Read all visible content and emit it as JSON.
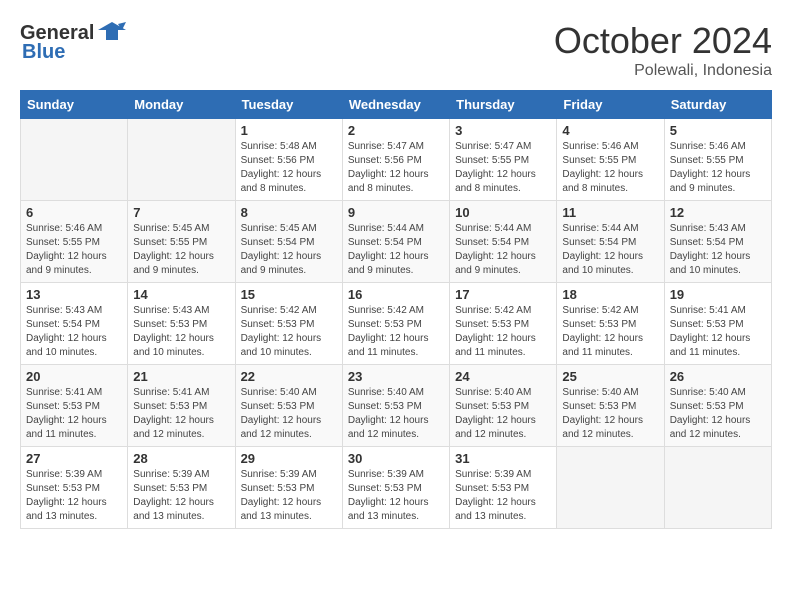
{
  "header": {
    "logo_general": "General",
    "logo_blue": "Blue",
    "month": "October 2024",
    "location": "Polewali, Indonesia"
  },
  "weekdays": [
    "Sunday",
    "Monday",
    "Tuesday",
    "Wednesday",
    "Thursday",
    "Friday",
    "Saturday"
  ],
  "weeks": [
    [
      {
        "day": "",
        "info": ""
      },
      {
        "day": "",
        "info": ""
      },
      {
        "day": "1",
        "info": "Sunrise: 5:48 AM\nSunset: 5:56 PM\nDaylight: 12 hours\nand 8 minutes."
      },
      {
        "day": "2",
        "info": "Sunrise: 5:47 AM\nSunset: 5:56 PM\nDaylight: 12 hours\nand 8 minutes."
      },
      {
        "day": "3",
        "info": "Sunrise: 5:47 AM\nSunset: 5:55 PM\nDaylight: 12 hours\nand 8 minutes."
      },
      {
        "day": "4",
        "info": "Sunrise: 5:46 AM\nSunset: 5:55 PM\nDaylight: 12 hours\nand 8 minutes."
      },
      {
        "day": "5",
        "info": "Sunrise: 5:46 AM\nSunset: 5:55 PM\nDaylight: 12 hours\nand 9 minutes."
      }
    ],
    [
      {
        "day": "6",
        "info": "Sunrise: 5:46 AM\nSunset: 5:55 PM\nDaylight: 12 hours\nand 9 minutes."
      },
      {
        "day": "7",
        "info": "Sunrise: 5:45 AM\nSunset: 5:55 PM\nDaylight: 12 hours\nand 9 minutes."
      },
      {
        "day": "8",
        "info": "Sunrise: 5:45 AM\nSunset: 5:54 PM\nDaylight: 12 hours\nand 9 minutes."
      },
      {
        "day": "9",
        "info": "Sunrise: 5:44 AM\nSunset: 5:54 PM\nDaylight: 12 hours\nand 9 minutes."
      },
      {
        "day": "10",
        "info": "Sunrise: 5:44 AM\nSunset: 5:54 PM\nDaylight: 12 hours\nand 9 minutes."
      },
      {
        "day": "11",
        "info": "Sunrise: 5:44 AM\nSunset: 5:54 PM\nDaylight: 12 hours\nand 10 minutes."
      },
      {
        "day": "12",
        "info": "Sunrise: 5:43 AM\nSunset: 5:54 PM\nDaylight: 12 hours\nand 10 minutes."
      }
    ],
    [
      {
        "day": "13",
        "info": "Sunrise: 5:43 AM\nSunset: 5:54 PM\nDaylight: 12 hours\nand 10 minutes."
      },
      {
        "day": "14",
        "info": "Sunrise: 5:43 AM\nSunset: 5:53 PM\nDaylight: 12 hours\nand 10 minutes."
      },
      {
        "day": "15",
        "info": "Sunrise: 5:42 AM\nSunset: 5:53 PM\nDaylight: 12 hours\nand 10 minutes."
      },
      {
        "day": "16",
        "info": "Sunrise: 5:42 AM\nSunset: 5:53 PM\nDaylight: 12 hours\nand 11 minutes."
      },
      {
        "day": "17",
        "info": "Sunrise: 5:42 AM\nSunset: 5:53 PM\nDaylight: 12 hours\nand 11 minutes."
      },
      {
        "day": "18",
        "info": "Sunrise: 5:42 AM\nSunset: 5:53 PM\nDaylight: 12 hours\nand 11 minutes."
      },
      {
        "day": "19",
        "info": "Sunrise: 5:41 AM\nSunset: 5:53 PM\nDaylight: 12 hours\nand 11 minutes."
      }
    ],
    [
      {
        "day": "20",
        "info": "Sunrise: 5:41 AM\nSunset: 5:53 PM\nDaylight: 12 hours\nand 11 minutes."
      },
      {
        "day": "21",
        "info": "Sunrise: 5:41 AM\nSunset: 5:53 PM\nDaylight: 12 hours\nand 12 minutes."
      },
      {
        "day": "22",
        "info": "Sunrise: 5:40 AM\nSunset: 5:53 PM\nDaylight: 12 hours\nand 12 minutes."
      },
      {
        "day": "23",
        "info": "Sunrise: 5:40 AM\nSunset: 5:53 PM\nDaylight: 12 hours\nand 12 minutes."
      },
      {
        "day": "24",
        "info": "Sunrise: 5:40 AM\nSunset: 5:53 PM\nDaylight: 12 hours\nand 12 minutes."
      },
      {
        "day": "25",
        "info": "Sunrise: 5:40 AM\nSunset: 5:53 PM\nDaylight: 12 hours\nand 12 minutes."
      },
      {
        "day": "26",
        "info": "Sunrise: 5:40 AM\nSunset: 5:53 PM\nDaylight: 12 hours\nand 12 minutes."
      }
    ],
    [
      {
        "day": "27",
        "info": "Sunrise: 5:39 AM\nSunset: 5:53 PM\nDaylight: 12 hours\nand 13 minutes."
      },
      {
        "day": "28",
        "info": "Sunrise: 5:39 AM\nSunset: 5:53 PM\nDaylight: 12 hours\nand 13 minutes."
      },
      {
        "day": "29",
        "info": "Sunrise: 5:39 AM\nSunset: 5:53 PM\nDaylight: 12 hours\nand 13 minutes."
      },
      {
        "day": "30",
        "info": "Sunrise: 5:39 AM\nSunset: 5:53 PM\nDaylight: 12 hours\nand 13 minutes."
      },
      {
        "day": "31",
        "info": "Sunrise: 5:39 AM\nSunset: 5:53 PM\nDaylight: 12 hours\nand 13 minutes."
      },
      {
        "day": "",
        "info": ""
      },
      {
        "day": "",
        "info": ""
      }
    ]
  ]
}
